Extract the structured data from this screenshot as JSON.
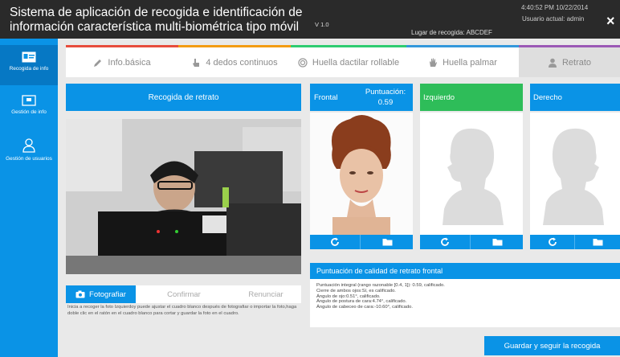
{
  "header": {
    "title": "Sistema de aplicación de recogida e identificación de información característica multi-biométrica tipo móvil",
    "version": "V 1.0",
    "location": "Lugar de recogida: ABCDEF",
    "datetime": "4:40:52 PM 10/22/2014",
    "user": "Usuario actual: admin",
    "close": "×"
  },
  "sidebar": {
    "items": [
      {
        "label": "Recogida de info",
        "icon": "id-card-icon"
      },
      {
        "label": "Gestión de info",
        "icon": "document-icon"
      },
      {
        "label": "Gestión de usuarios",
        "icon": "user-icon"
      }
    ]
  },
  "tabs": [
    {
      "label": "Info.básica",
      "icon": "pencil-icon",
      "color": "#e74c3c"
    },
    {
      "label": "4 dedos continuos",
      "icon": "hand-pointer-icon",
      "color": "#f39c12"
    },
    {
      "label": "Huella dactilar rollable",
      "icon": "fingerprint-icon",
      "color": "#2ecc71"
    },
    {
      "label": "Huella palmar",
      "icon": "palm-icon",
      "color": "#3498db"
    },
    {
      "label": "Retrato",
      "icon": "person-icon",
      "color": "#9b59b6"
    }
  ],
  "left": {
    "title": "Recogida de retrato",
    "buttons": {
      "photo": "Fotografiar",
      "confirm": "Confirmar",
      "cancel": "Renunciar"
    },
    "hint": "Inicia a recoger la foto Izquierdoy puede ajustar el cuadro blanco después de fotografiar o importar la foto,haga doble clic en el ratón en el cuadro blanco para cortar y guardar la foto en el cuadro."
  },
  "cards": [
    {
      "title": "Frontal",
      "score_label": "Puntuación:",
      "score": "0.59",
      "color": "#0a93e6"
    },
    {
      "title": "Izquierdo",
      "color": "#2ebd59"
    },
    {
      "title": "Derecho",
      "color": "#0a93e6"
    }
  ],
  "quality": {
    "title": "Puntuación de calidad de retrato frontal",
    "lines": [
      "Puntuación integral (rango razonable [0.4, 1]): 0.59, calificado.",
      "Cierre de ambos ojos:Sí, es calificado.",
      "Ángulo de ojo:0.51°, calificado.",
      "Ángulo de postura de cara:4.74°, calificado.",
      "Ángulo de cabeceo de cara:-10.60°, calificado."
    ]
  },
  "save": "Guardar y seguir la recogida"
}
